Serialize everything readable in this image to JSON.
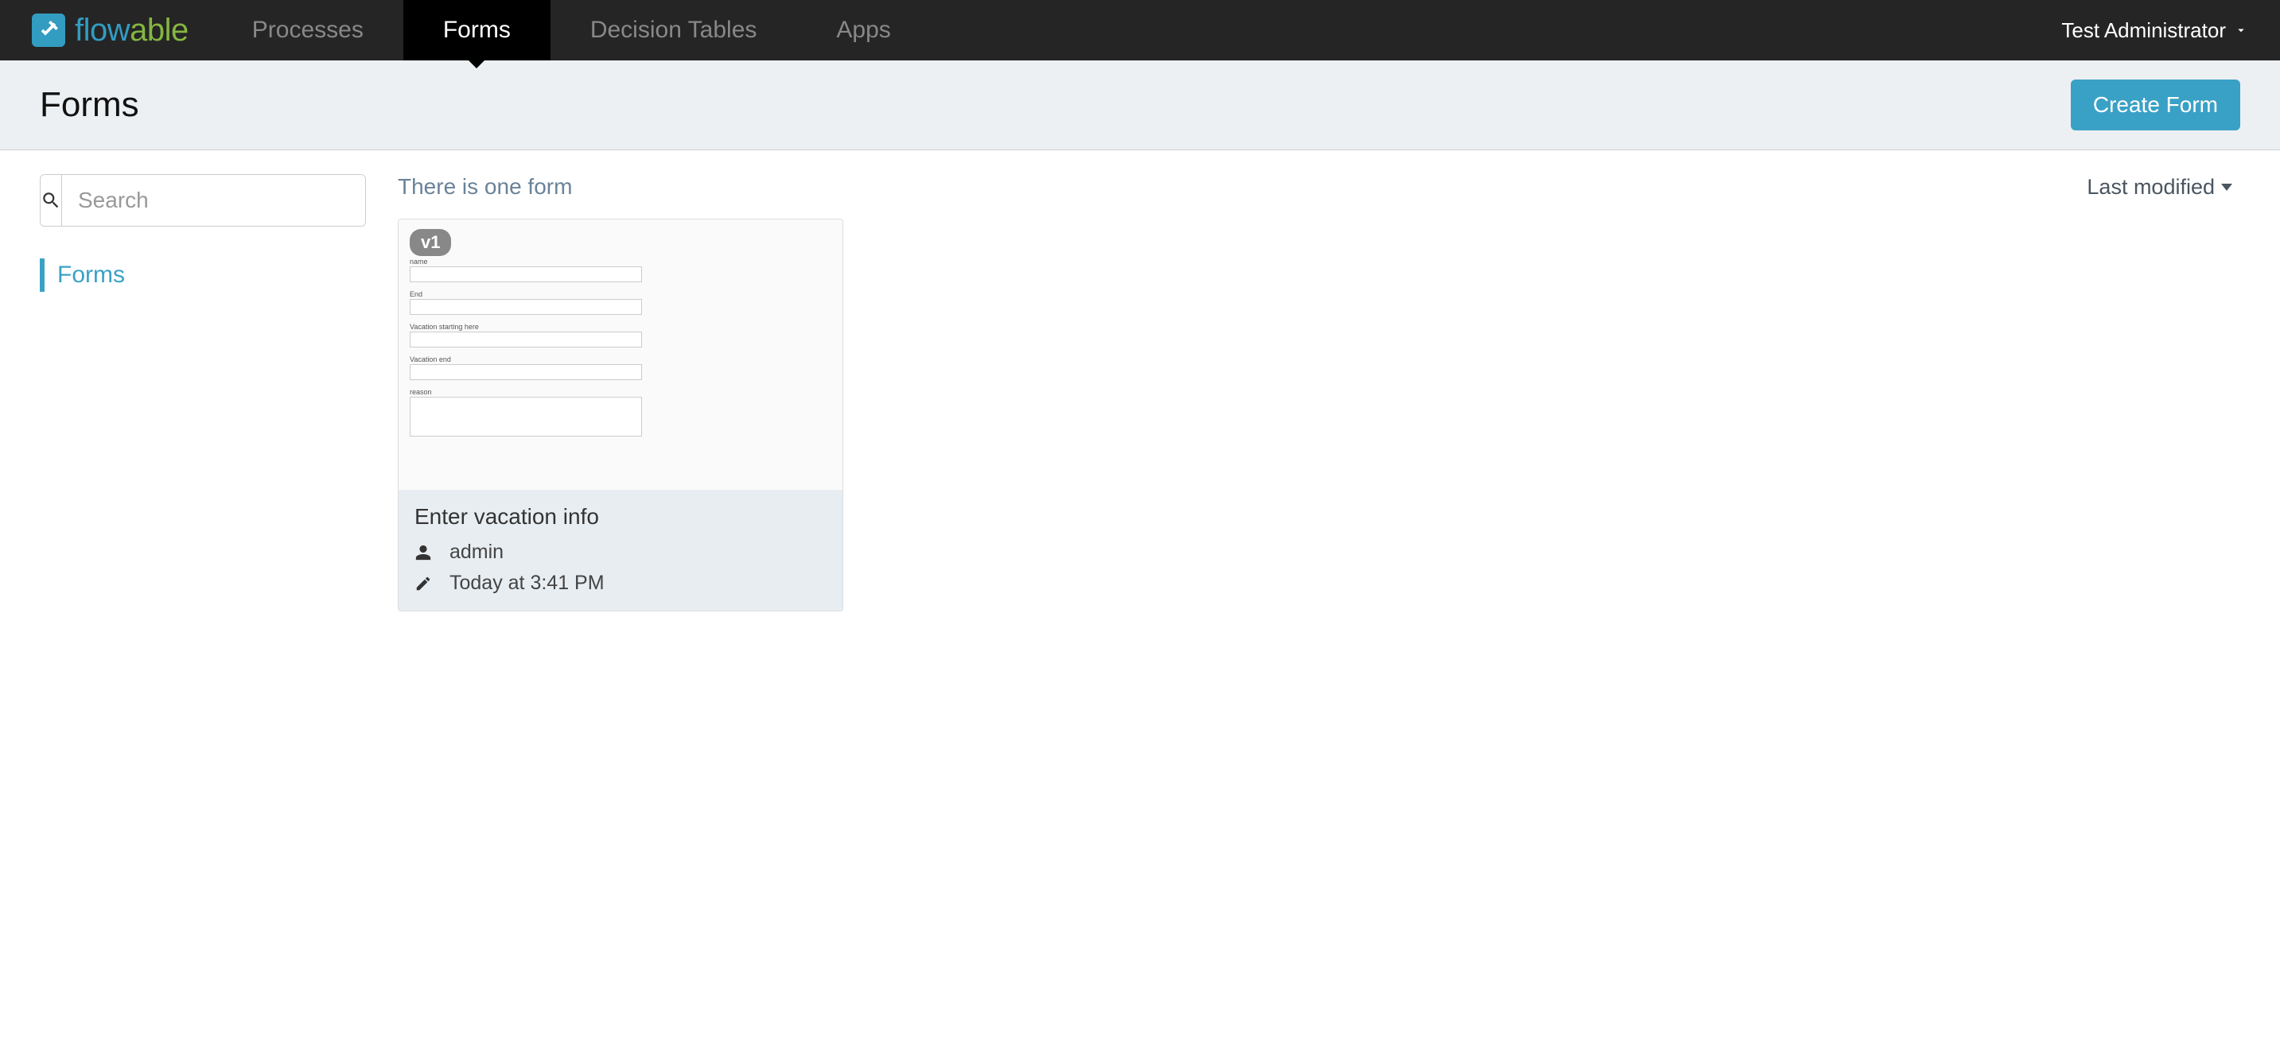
{
  "brand": {
    "part1": "flow",
    "part2": "able"
  },
  "nav": {
    "tabs": [
      {
        "label": "Processes",
        "active": false
      },
      {
        "label": "Forms",
        "active": true
      },
      {
        "label": "Decision Tables",
        "active": false
      },
      {
        "label": "Apps",
        "active": false
      }
    ],
    "user_label": "Test Administrator"
  },
  "subheader": {
    "title": "Forms",
    "create_button": "Create Form"
  },
  "sidebar": {
    "search_placeholder": "Search",
    "filters": [
      {
        "label": "Forms"
      }
    ]
  },
  "content": {
    "count_text": "There is one form",
    "sort_label": "Last modified"
  },
  "cards": [
    {
      "version_badge": "v1",
      "title": "Enter vacation info",
      "author": "admin",
      "modified": "Today at 3:41 PM",
      "preview_fields": [
        {
          "label": "name",
          "tall": false
        },
        {
          "label": "End",
          "tall": false
        },
        {
          "label": "Vacation starting here",
          "tall": false
        },
        {
          "label": "Vacation end",
          "tall": false
        },
        {
          "label": "reason",
          "tall": true
        }
      ]
    }
  ]
}
